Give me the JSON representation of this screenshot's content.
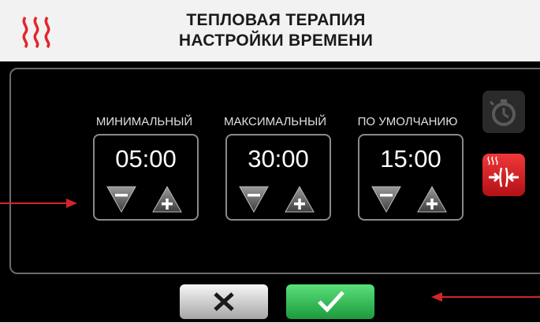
{
  "header": {
    "title_line1": "ТЕПЛОВАЯ ТЕРАПИЯ",
    "title_line2": "НАСТРОЙКИ ВРЕМЕНИ",
    "icon": "heat-waves-icon"
  },
  "settings": [
    {
      "label": "МИНИМАЛЬНЫЙ",
      "value": "05:00"
    },
    {
      "label": "МАКСИМАЛЬНЫЙ",
      "value": "30:00"
    },
    {
      "label": "ПО УМОЛЧАНИЮ",
      "value": "15:00"
    }
  ],
  "side_buttons": {
    "timer_icon": "stopwatch-icon",
    "return_icon": "heat-return-icon"
  },
  "bottom": {
    "cancel_icon": "close-icon",
    "confirm_icon": "checkmark-icon"
  },
  "colors": {
    "accent_red": "#e3262b",
    "confirm_green": "#39c45a",
    "background": "#000000"
  }
}
